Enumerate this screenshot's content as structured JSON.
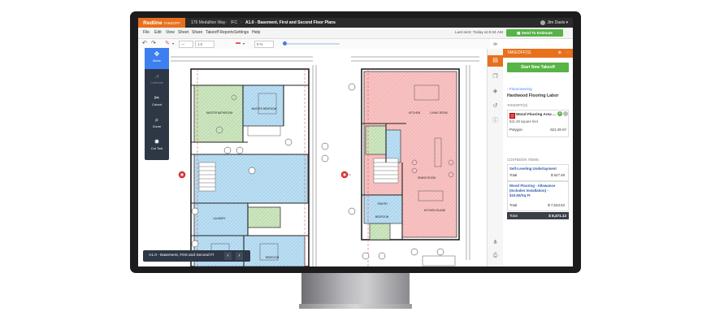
{
  "app": {
    "logo": "Redline",
    "logo_suffix": "TAKEOFF",
    "project": "175 Medallion Way",
    "set": "IFC",
    "sheet_title": "A1.0 - Basement, First and Second Floor Plans",
    "user": "Jim Davis"
  },
  "menu": {
    "items": [
      "File",
      "Edit",
      "View",
      "Sheet",
      "Share",
      "Takeoff Reports",
      "Settings",
      "Help"
    ],
    "last_sent": "Last sent: Today at 8:34 AM",
    "send_button": "Send To Estimate"
  },
  "toolbar": {
    "undo_icon": "undo-icon",
    "redo_icon": "redo-icon",
    "line_width": "1.0",
    "opacity": "0 %",
    "zoom_fraction": 0.0
  },
  "tools": [
    {
      "label": "Move",
      "icon": "move-icon",
      "glyph": "✥",
      "active": true
    },
    {
      "label": "Calibrate",
      "icon": "calibrate-icon",
      "glyph": "⩘",
      "active": false,
      "dim": true
    },
    {
      "label": "Cutout",
      "icon": "cutout-icon",
      "glyph": "✂",
      "active": false
    },
    {
      "label": "Zoom",
      "icon": "zoom-icon",
      "glyph": "⌕",
      "active": false
    },
    {
      "label": "Cut Tool",
      "icon": "cut-tool-icon",
      "glyph": "✹",
      "active": false
    }
  ],
  "sheet_nav": {
    "label": "A1.0 - Basement, First and Second Fl",
    "prev": "‹",
    "next": "›"
  },
  "plan_labels": {
    "rooms_left": [
      "MASTER BATHROOM",
      "MASTER BEDROOM",
      "LAUNDRY",
      "BEDROOM",
      "BEDROOM"
    ],
    "rooms_right": [
      "KITCHEN",
      "LIVING ROOM",
      "DINING ROOM",
      "PANTRY",
      "BEDROOM",
      "KITCHEN ISLAND"
    ]
  },
  "rail": {
    "collapse": "≫",
    "icons": [
      "takeoff-icon",
      "copy-icon",
      "layers-icon",
      "history-icon",
      "info-icon",
      "share-icon",
      "print-icon"
    ]
  },
  "panel": {
    "header": "TAKEOFF(S)",
    "start_button": "Start New Takeoff",
    "back_link": "‹ Floorcovering",
    "title": "Hardwood Flooring Labor",
    "takeoffs_label": "TAKEOFF(S)",
    "takeoff_name": "Wood Flooring Area ...",
    "takeoff_area": "621.49 square feet",
    "polygon_label": "Polygon",
    "polygon_value": "621.49 m²",
    "costbook_label": "COSTBOOK ITEMS:",
    "items": [
      {
        "name": "Self-Leveling Underlayment",
        "total_label": "Total",
        "total": "$ 627.49"
      },
      {
        "name": "Wood Flooring - Allowance (Includes Installation) - $10.50/Sq Ft",
        "total_label": "Total",
        "total": "$ 7,643.63"
      }
    ],
    "grand_total_label": "Total",
    "grand_total": "$ 8,471.12"
  },
  "colors": {
    "brand_orange": "#e8701d",
    "success_green": "#57b446",
    "tool_panel": "#2d3745",
    "active_blue": "#3d7ff0",
    "takeoff_pink": "#f5a6a6",
    "takeoff_blue": "#a9d3ef",
    "takeoff_green": "#b9d8a8"
  }
}
